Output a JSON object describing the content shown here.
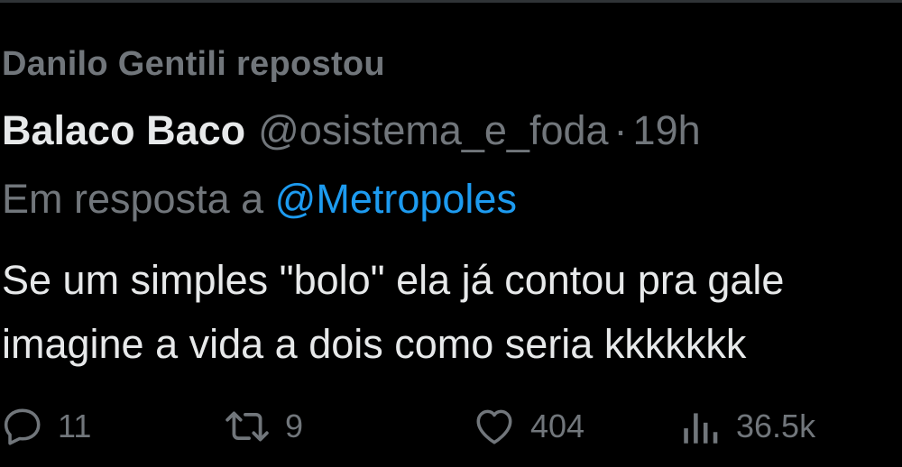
{
  "repost": {
    "text": "Danilo Gentili repostou"
  },
  "tweet": {
    "display_name": "Balaco Baco",
    "handle": "@osistema_e_foda",
    "separator": "·",
    "time": "19h",
    "reply_prefix": "Em resposta a",
    "reply_handle": "@Metropoles",
    "lines": [
      "Se um simples \"bolo\" ela já contou pra gale",
      "imagine a vida a dois como seria kkkkkkk"
    ]
  },
  "actions": {
    "replies": "11",
    "reposts": "9",
    "likes": "404",
    "views": "36.5k"
  },
  "colors": {
    "background": "#000000",
    "text": "#e7e9ea",
    "muted": "#71767b",
    "link": "#1d9bf0"
  },
  "icons": {
    "reply": "reply-icon",
    "retweet": "retweet-icon",
    "like": "heart-icon",
    "views": "views-icon"
  }
}
